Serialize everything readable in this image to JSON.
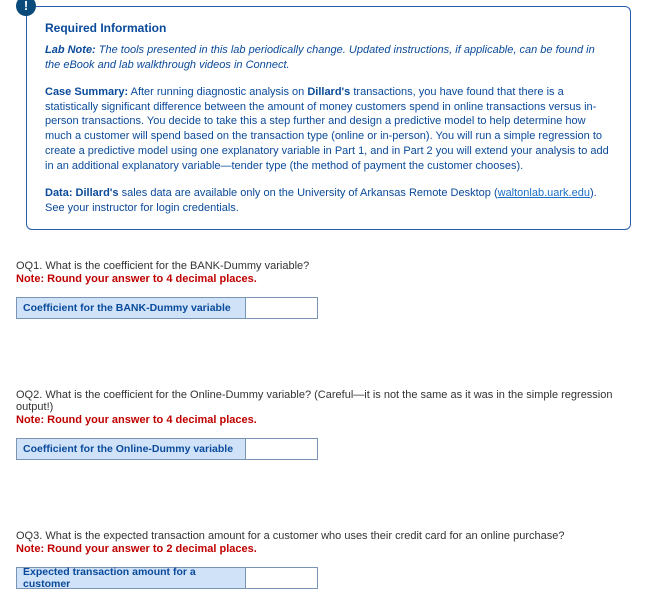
{
  "info": {
    "badge_glyph": "!",
    "required_title": "Required Information",
    "lab_note_label": "Lab Note:",
    "lab_note_text": " The tools presented in this lab periodically change. Updated instructions, if applicable, can be found in the eBook and lab walkthrough videos in Connect.",
    "case_label": "Case Summary:",
    "case_text_1": " After running diagnostic analysis on ",
    "case_bold_1": "Dillard's",
    "case_text_2": " transactions, you have found that there is a statistically significant difference between the amount of money customers spend in online transactions versus in-person transactions. You decide to take this a step further and design a predictive model to help determine how much a customer will spend based on the transaction type (online or in-person). You will run a simple regression to create a predictive model using one explanatory variable in Part 1, and in Part 2 you will extend your analysis to add in an additional explanatory variable—tender type (the method of payment the customer chooses).",
    "data_label": "Data: Dillard's",
    "data_text_1": " sales data are available only on the University of Arkansas Remote Desktop (",
    "data_link": "waltonlab.uark.edu",
    "data_text_2": "). See your instructor for login credentials."
  },
  "q1": {
    "prompt": "OQ1. What is the coefficient for the BANK-Dummy variable?",
    "note": "Note: Round your answer to 4 decimal places.",
    "label": "Coefficient for the BANK-Dummy variable"
  },
  "q2": {
    "prompt": "OQ2. What is the coefficient for the Online-Dummy variable? (Careful—it is not the same as it was in the simple regression output!)",
    "note": "Note: Round your answer to 4 decimal places.",
    "label": "Coefficient for the Online-Dummy variable"
  },
  "q3": {
    "prompt": "OQ3. What is the expected transaction amount for a customer who uses their credit card for an online purchase?",
    "note": "Note: Round your answer to 2 decimal places.",
    "label": "Expected transaction amount for a customer"
  }
}
